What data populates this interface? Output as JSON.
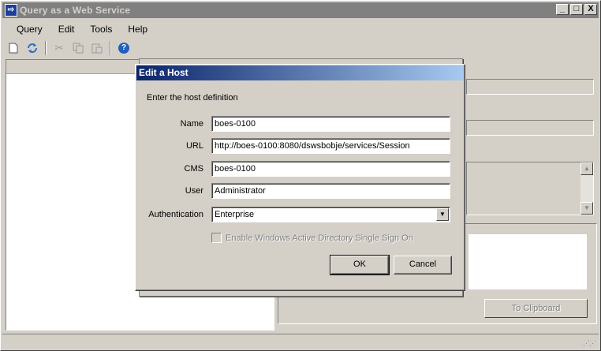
{
  "window": {
    "title": "Query as a Web Service",
    "controls": {
      "minimize": "_",
      "maximize": "□",
      "close": "X"
    }
  },
  "menu": [
    "Query",
    "Edit",
    "Tools",
    "Help"
  ],
  "toolbar": {
    "icons": [
      "new-document-icon",
      "refresh-icon",
      "cut-icon",
      "copy-icon",
      "paste-icon",
      "help-icon"
    ]
  },
  "right_panel": {
    "clipboard_button": "To Clipboard"
  },
  "dialog": {
    "title": "Edit a Host",
    "intro": "Enter the host definition",
    "fields": {
      "name": {
        "label": "Name",
        "value": "boes-0100"
      },
      "url": {
        "label": "URL",
        "value": "http://boes-0100:8080/dswsbobje/services/Session"
      },
      "cms": {
        "label": "CMS",
        "value": "boes-0100"
      },
      "user": {
        "label": "User",
        "value": "Administrator"
      },
      "authentication": {
        "label": "Authentication",
        "value": "Enterprise"
      }
    },
    "sso_checkbox": {
      "label": "Enable Windows Active Directory Single Sign On",
      "checked": false,
      "enabled": false
    },
    "ok": "OK",
    "cancel": "Cancel"
  }
}
